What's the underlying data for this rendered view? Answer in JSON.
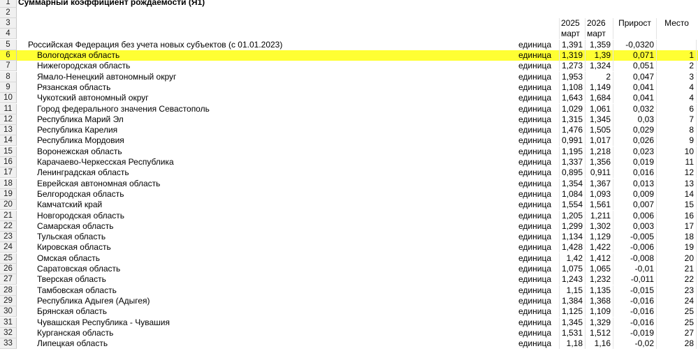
{
  "sheet": {
    "title": "Суммарный коэффициент рождаемости (Я1)",
    "header": {
      "y2025": "2025",
      "y2026": "2026",
      "month1": "март",
      "month2": "март",
      "growth": "Прирост",
      "place": "Место"
    },
    "total": {
      "row": "5",
      "name": "Российская Федерация без учета новых субъектов (с 01.01.2023)",
      "unit": "единица",
      "v2025": "1,391",
      "v2026": "1,359",
      "growth": "-0,0320",
      "place": ""
    },
    "rows": [
      {
        "row": "6",
        "name": "Вологодская область",
        "unit": "единица",
        "v2025": "1,319",
        "v2026": "1,39",
        "growth": "0,071",
        "place": "1"
      },
      {
        "row": "7",
        "name": "Нижегородская область",
        "unit": "единица",
        "v2025": "1,273",
        "v2026": "1,324",
        "growth": "0,051",
        "place": "2"
      },
      {
        "row": "8",
        "name": "Ямало-Ненецкий автономный округ",
        "unit": "единица",
        "v2025": "1,953",
        "v2026": "2",
        "growth": "0,047",
        "place": "3"
      },
      {
        "row": "9",
        "name": "Рязанская область",
        "unit": "единица",
        "v2025": "1,108",
        "v2026": "1,149",
        "growth": "0,041",
        "place": "4"
      },
      {
        "row": "10",
        "name": "Чукотский автономный округ",
        "unit": "единица",
        "v2025": "1,643",
        "v2026": "1,684",
        "growth": "0,041",
        "place": "4"
      },
      {
        "row": "11",
        "name": "Город федерального значения Севастополь",
        "unit": "единица",
        "v2025": "1,029",
        "v2026": "1,061",
        "growth": "0,032",
        "place": "6"
      },
      {
        "row": "12",
        "name": "Республика Марий Эл",
        "unit": "единица",
        "v2025": "1,315",
        "v2026": "1,345",
        "growth": "0,03",
        "place": "7"
      },
      {
        "row": "13",
        "name": "Республика Карелия",
        "unit": "единица",
        "v2025": "1,476",
        "v2026": "1,505",
        "growth": "0,029",
        "place": "8"
      },
      {
        "row": "14",
        "name": "Республика Мордовия",
        "unit": "единица",
        "v2025": "0,991",
        "v2026": "1,017",
        "growth": "0,026",
        "place": "9"
      },
      {
        "row": "15",
        "name": "Воронежская область",
        "unit": "единица",
        "v2025": "1,195",
        "v2026": "1,218",
        "growth": "0,023",
        "place": "10"
      },
      {
        "row": "16",
        "name": "Карачаево-Черкесская Республика",
        "unit": "единица",
        "v2025": "1,337",
        "v2026": "1,356",
        "growth": "0,019",
        "place": "11"
      },
      {
        "row": "17",
        "name": "Ленинградская область",
        "unit": "единица",
        "v2025": "0,895",
        "v2026": "0,911",
        "growth": "0,016",
        "place": "12"
      },
      {
        "row": "18",
        "name": "Еврейская автономная область",
        "unit": "единица",
        "v2025": "1,354",
        "v2026": "1,367",
        "growth": "0,013",
        "place": "13"
      },
      {
        "row": "19",
        "name": "Белгородская область",
        "unit": "единица",
        "v2025": "1,084",
        "v2026": "1,093",
        "growth": "0,009",
        "place": "14"
      },
      {
        "row": "20",
        "name": "Камчатский край",
        "unit": "единица",
        "v2025": "1,554",
        "v2026": "1,561",
        "growth": "0,007",
        "place": "15"
      },
      {
        "row": "21",
        "name": "Новгородская область",
        "unit": "единица",
        "v2025": "1,205",
        "v2026": "1,211",
        "growth": "0,006",
        "place": "16"
      },
      {
        "row": "22",
        "name": "Самарская область",
        "unit": "единица",
        "v2025": "1,299",
        "v2026": "1,302",
        "growth": "0,003",
        "place": "17"
      },
      {
        "row": "23",
        "name": "Тульская область",
        "unit": "единица",
        "v2025": "1,134",
        "v2026": "1,129",
        "growth": "-0,005",
        "place": "18"
      },
      {
        "row": "24",
        "name": "Кировская область",
        "unit": "единица",
        "v2025": "1,428",
        "v2026": "1,422",
        "growth": "-0,006",
        "place": "19"
      },
      {
        "row": "25",
        "name": "Омская область",
        "unit": "единица",
        "v2025": "1,42",
        "v2026": "1,412",
        "growth": "-0,008",
        "place": "20"
      },
      {
        "row": "26",
        "name": "Саратовская область",
        "unit": "единица",
        "v2025": "1,075",
        "v2026": "1,065",
        "growth": "-0,01",
        "place": "21"
      },
      {
        "row": "27",
        "name": "Тверская область",
        "unit": "единица",
        "v2025": "1,243",
        "v2026": "1,232",
        "growth": "-0,011",
        "place": "22"
      },
      {
        "row": "28",
        "name": "Тамбовская область",
        "unit": "единица",
        "v2025": "1,15",
        "v2026": "1,135",
        "growth": "-0,015",
        "place": "23"
      },
      {
        "row": "29",
        "name": "Республика Адыгея (Адыгея)",
        "unit": "единица",
        "v2025": "1,384",
        "v2026": "1,368",
        "growth": "-0,016",
        "place": "24"
      },
      {
        "row": "30",
        "name": "Брянская область",
        "unit": "единица",
        "v2025": "1,125",
        "v2026": "1,109",
        "growth": "-0,016",
        "place": "25"
      },
      {
        "row": "31",
        "name": "Чувашская Республика - Чувашия",
        "unit": "единица",
        "v2025": "1,345",
        "v2026": "1,329",
        "growth": "-0,016",
        "place": "25"
      },
      {
        "row": "32",
        "name": "Курганская область",
        "unit": "единица",
        "v2025": "1,531",
        "v2026": "1,512",
        "growth": "-0,019",
        "place": "27"
      },
      {
        "row": "33",
        "name": "Липецкая область",
        "unit": "единица",
        "v2025": "1,18",
        "v2026": "1,16",
        "growth": "-0,02",
        "place": "28"
      }
    ],
    "highlight_color": "#ffff33"
  }
}
